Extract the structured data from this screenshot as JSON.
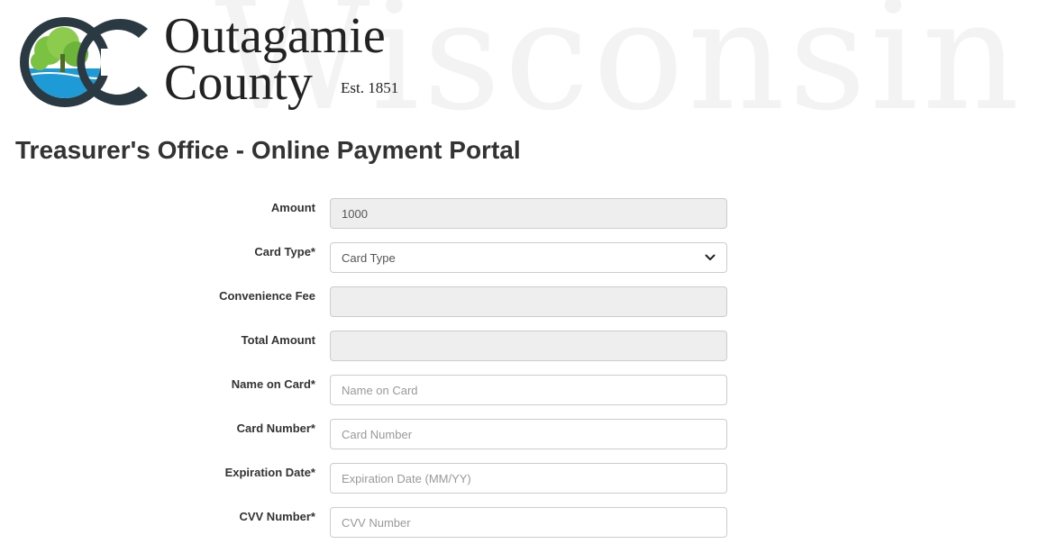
{
  "header": {
    "logo_line1": "Outagamie",
    "logo_line2": "County",
    "logo_est": "Est. 1851",
    "watermark": "Wisconsin",
    "logo_colors": {
      "ring_dark": "#2b3a42",
      "tree_green": "#7cc242",
      "water_blue": "#1e9ad6"
    }
  },
  "page": {
    "title": "Treasurer's Office - Online Payment Portal"
  },
  "form": {
    "amount": {
      "label": "Amount",
      "value": "1000"
    },
    "card_type": {
      "label": "Card Type*",
      "selected": "Card Type",
      "icon": "chevron-down-icon"
    },
    "convenience_fee": {
      "label": "Convenience Fee",
      "value": ""
    },
    "total_amount": {
      "label": "Total Amount",
      "value": ""
    },
    "name_on_card": {
      "label": "Name on Card*",
      "placeholder": "Name on Card"
    },
    "card_number": {
      "label": "Card Number*",
      "placeholder": "Card Number"
    },
    "expiration_date": {
      "label": "Expiration Date*",
      "placeholder": "Expiration Date (MM/YY)"
    },
    "cvv_number": {
      "label": "CVV Number*",
      "placeholder": "CVV Number"
    }
  }
}
